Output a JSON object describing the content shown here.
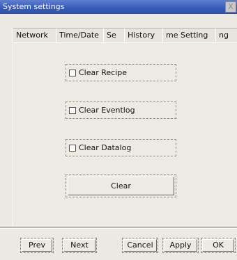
{
  "window": {
    "title": "System settings",
    "close_glyph": "X"
  },
  "tabs": [
    {
      "label": "Network"
    },
    {
      "label": "Time/Date"
    },
    {
      "label": "Se"
    },
    {
      "label": "History"
    },
    {
      "label": "me Setting"
    },
    {
      "label": "ng"
    }
  ],
  "options": [
    {
      "label": "Clear Recipe",
      "checked": false
    },
    {
      "label": "Clear Eventlog",
      "checked": false
    },
    {
      "label": "Clear Datalog",
      "checked": false
    }
  ],
  "clear_button": {
    "label": "Clear"
  },
  "footer": {
    "prev_label": "Prev",
    "next_label": "Next",
    "cancel_label": "Cancel",
    "apply_label": "Apply",
    "ok_label": "OK"
  },
  "colors": {
    "titlebar": "#3a5cb9",
    "window_bg": "#ece9e2"
  }
}
